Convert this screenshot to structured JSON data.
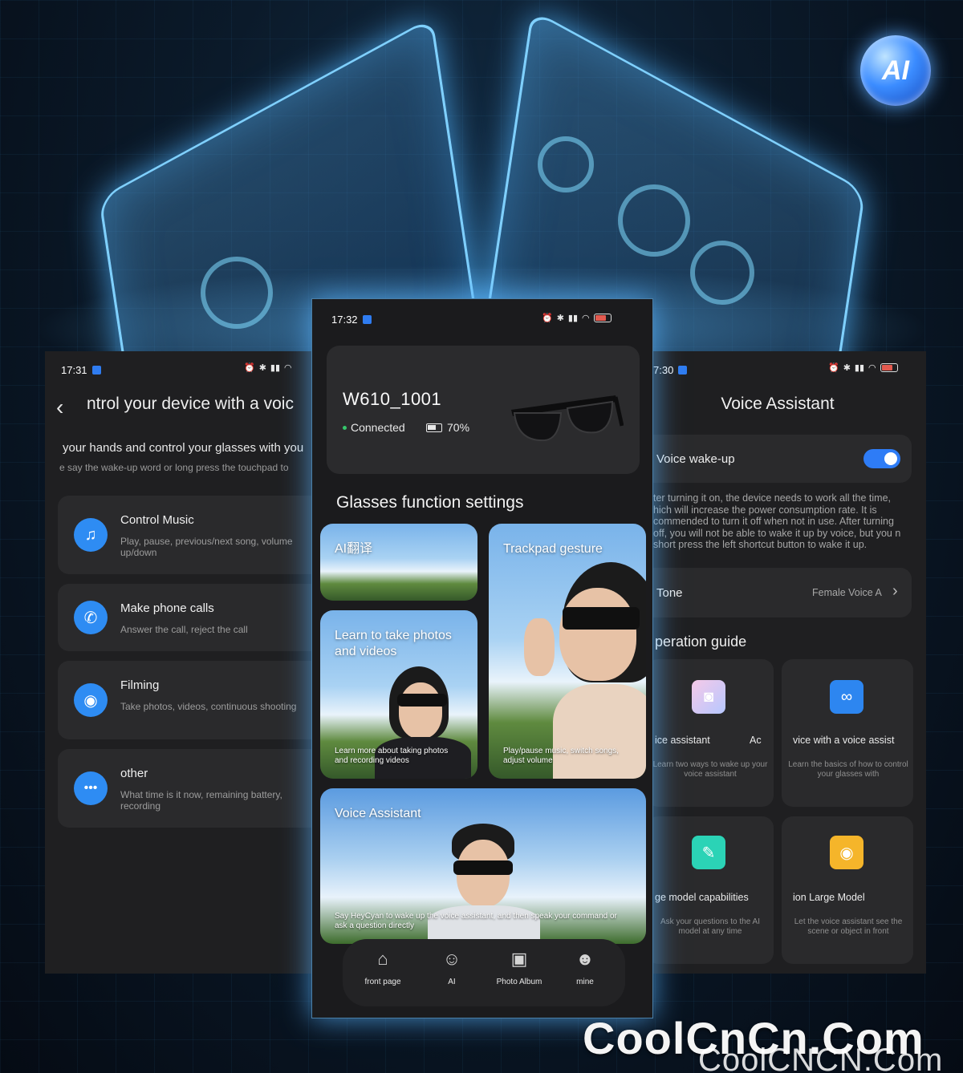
{
  "left_screen": {
    "time": "17:31",
    "title": "ntrol your device with a voic",
    "intro": "your hands and control your glasses with you",
    "sub": "e say the wake-up word or long press the touchpad to",
    "items": [
      {
        "title": "Control Music",
        "desc": "Play, pause, previous/next song, volume up/down",
        "icon": "music-note-icon"
      },
      {
        "title": "Make phone calls",
        "desc": "Answer the call, reject the call",
        "icon": "phone-icon"
      },
      {
        "title": "Filming",
        "desc": "Take photos, videos, continuous shooting",
        "icon": "camera-icon"
      },
      {
        "title": "other",
        "desc": "What time is it now, remaining battery, recording",
        "icon": "more-dots-icon"
      }
    ]
  },
  "center_screen": {
    "time": "17:32",
    "device": {
      "name": "W610_1001",
      "status": "Connected",
      "battery": "70%"
    },
    "section_title": "Glasses function settings",
    "tiles": {
      "translate": {
        "label": "AI翻译"
      },
      "trackpad": {
        "label": "Trackpad gesture",
        "caption": "Play/pause music, switch songs, adjust volume"
      },
      "photos": {
        "label": "Learn to take photos and videos",
        "caption": "Learn more about taking photos and recording videos"
      },
      "voice": {
        "label": "Voice Assistant",
        "caption": "Say HeyCyan to wake up the voice assistant, and then speak your command or ask a question directly"
      }
    },
    "tabs": [
      {
        "label": "front page",
        "icon": "home-icon"
      },
      {
        "label": "AI",
        "icon": "robot-icon"
      },
      {
        "label": "Photo Album",
        "icon": "image-icon"
      },
      {
        "label": "mine",
        "icon": "person-icon"
      }
    ]
  },
  "right_screen": {
    "time": "7:30",
    "title": "Voice Assistant",
    "wake_label": "Voice wake-up",
    "wake_enabled": true,
    "wake_desc": "ter turning it on, the device needs to work all the time, hich will increase the power consumption rate. It is commended to turn it off when not in use. After turning off, you will not be able to wake it up by voice, but you n short press the left shortcut button to wake it up.",
    "tone_label": "Tone",
    "tone_value": "Female Voice A",
    "guide_title": "peration guide",
    "guide_cards": [
      {
        "title": "ice assistant",
        "title_right": "Ac",
        "desc": "Learn two ways to wake up your voice assistant",
        "icon": "robot-face-icon"
      },
      {
        "title": "vice with a voice assist",
        "desc": "Learn the basics of how to control your glasses with",
        "icon": "glasses-icon"
      },
      {
        "title": "ge model capabilities",
        "desc": "Ask your questions to the AI model at any time",
        "icon": "edit-note-icon"
      },
      {
        "title": "ion Large Model",
        "desc": "Let the voice assistant see the scene or object in front",
        "icon": "eye-icon"
      }
    ]
  },
  "badge": {
    "label": "AI"
  },
  "watermark": {
    "primary": "CoolCnCn.Com",
    "secondary": "CoolCNCN.Com"
  },
  "colors": {
    "accent": "#2e8cf3",
    "card": "#2a2a2c",
    "screen": "#1f1f21",
    "glow": "#7fd0ff"
  }
}
